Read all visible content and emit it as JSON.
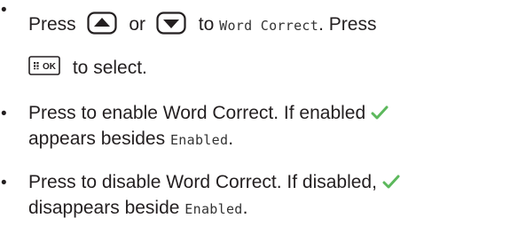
{
  "bullet_glyph": "•",
  "step1": {
    "press": "Press",
    "or": "or",
    "to_prefix": "to",
    "menu_item": "Word Correct",
    "after_menu": ". Press",
    "to_select": "to select.",
    "up_key": "up-arrow-key-icon",
    "down_key": "down-arrow-key-icon",
    "ok_key": "menu-ok-key-icon",
    "ok_key_label": "OK"
  },
  "enable_bullet": {
    "text_before_check": "Press to enable Word Correct. If enabled",
    "check_icon": "checkmark-icon",
    "line2_prefix": "appears besides",
    "enabled_label": "Enabled",
    "line2_suffix": "."
  },
  "disable_bullet": {
    "text_before_check": "Press to disable Word Correct. If disabled,",
    "check_icon": "checkmark-icon",
    "line2_prefix": "disappears beside",
    "enabled_label": "Enabled",
    "line2_suffix": "."
  },
  "colors": {
    "text": "#231f20",
    "check": "#5cb85c",
    "mono_text": "#333333"
  }
}
